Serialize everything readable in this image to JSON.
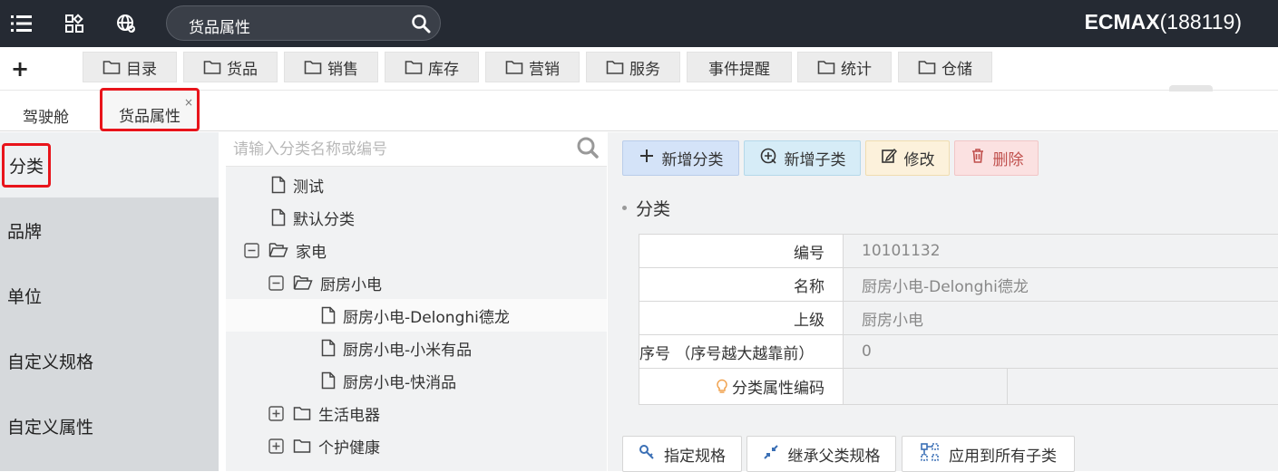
{
  "header": {
    "search_text": "货品属性",
    "brand": "ECMAX",
    "account": "(188119)",
    "icons": [
      "list-icon",
      "apps-icon",
      "globe-icon",
      "search-icon"
    ]
  },
  "menu": {
    "add_label": "+",
    "items": [
      {
        "label": "目录",
        "icon": "folder"
      },
      {
        "label": "货品",
        "icon": "folder"
      },
      {
        "label": "销售",
        "icon": "folder"
      },
      {
        "label": "库存",
        "icon": "folder"
      },
      {
        "label": "营销",
        "icon": "folder"
      },
      {
        "label": "服务",
        "icon": "folder"
      },
      {
        "label": "事件提醒",
        "icon": "none"
      },
      {
        "label": "统计",
        "icon": "folder"
      },
      {
        "label": "仓储",
        "icon": "folder"
      }
    ]
  },
  "tabs": {
    "items": [
      {
        "label": "驾驶舱"
      },
      {
        "label": "货品属性",
        "close": "×"
      }
    ]
  },
  "sidebar": {
    "items": [
      {
        "label": "分类"
      },
      {
        "label": "品牌"
      },
      {
        "label": "单位"
      },
      {
        "label": "自定义规格"
      },
      {
        "label": "自定义属性"
      }
    ]
  },
  "tree": {
    "search_placeholder": "请输入分类名称或编号",
    "nodes": [
      {
        "label": "测试",
        "type": "file"
      },
      {
        "label": "默认分类",
        "type": "file"
      },
      {
        "label": "家电",
        "type": "folder-open",
        "toggle": "minus"
      },
      {
        "label": "厨房小电",
        "type": "folder-open",
        "toggle": "minus"
      },
      {
        "label": "厨房小电-Delonghi德龙",
        "type": "file",
        "selected": true
      },
      {
        "label": "厨房小电-小米有品",
        "type": "file"
      },
      {
        "label": "厨房小电-快消品",
        "type": "file"
      },
      {
        "label": "生活电器",
        "type": "folder",
        "toggle": "plus"
      },
      {
        "label": "个护健康",
        "type": "folder",
        "toggle": "plus"
      }
    ]
  },
  "actions": {
    "add": "新增分类",
    "add_child": "新增子类",
    "edit": "修改",
    "delete": "删除"
  },
  "section": {
    "title": "分类"
  },
  "form": {
    "rows": [
      {
        "label": "编号",
        "value": "10101132"
      },
      {
        "label": "名称",
        "value": "厨房小电-Delonghi德龙"
      },
      {
        "label": "上级",
        "value": "厨房小电"
      },
      {
        "label": "序号 （序号越大越靠前）",
        "value": "0"
      },
      {
        "label": "分类属性编码",
        "value": ""
      }
    ]
  },
  "bottom_actions": {
    "specify": "指定规格",
    "inherit": "继承父类规格",
    "apply_all": "应用到所有子类"
  }
}
